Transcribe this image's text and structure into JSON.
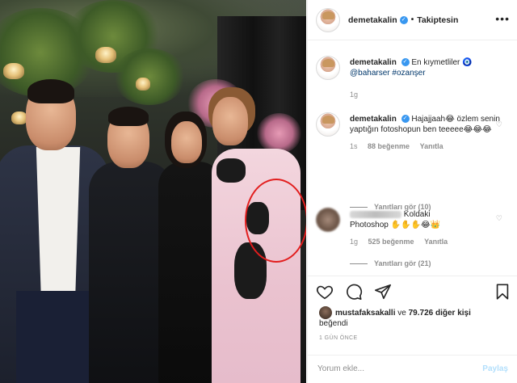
{
  "header": {
    "username": "demetakalin",
    "separator": "•",
    "follow_status": "Takiptesin",
    "more_icon": "more-icon"
  },
  "caption": {
    "username": "demetakalin",
    "text": "En kıymetliler",
    "emoji": "🧿",
    "mention": "@baharser",
    "hashtag": "#ozanşer",
    "time": "1g"
  },
  "comments": [
    {
      "username": "demetakalin",
      "text": "Hajajjaah😂 özlem senin yaptığın fotoshopun ben teeeee😂😂😂",
      "time": "1s",
      "likes": "88 beğenme",
      "reply": "Yanıtla",
      "view_replies": "Yanıtları gör (10)"
    },
    {
      "username": "",
      "text_prefix": "Koldaki",
      "text": "Photoshop ✋✋✋😂👑",
      "time": "1g",
      "likes": "525 beğenme",
      "reply": "Yanıtla",
      "view_replies": "Yanıtları gör (21)"
    }
  ],
  "actions": {
    "icons": [
      "heart-icon",
      "comment-icon",
      "share-icon",
      "bookmark-icon"
    ]
  },
  "likes": {
    "liker": "mustafaksakalli",
    "connector": "ve",
    "others": "79.726 diğer kişi",
    "suffix": "beğendi"
  },
  "timestamp": "1 GÜN ÖNCE",
  "add_comment": {
    "placeholder": "Yorum ekle...",
    "post_label": "Paylaş"
  },
  "colors": {
    "verified": "#3897f0",
    "link": "#00376b",
    "muted": "#8e8e8e",
    "post_disabled": "#b2dffc",
    "highlight_circle": "#e21d1d"
  }
}
